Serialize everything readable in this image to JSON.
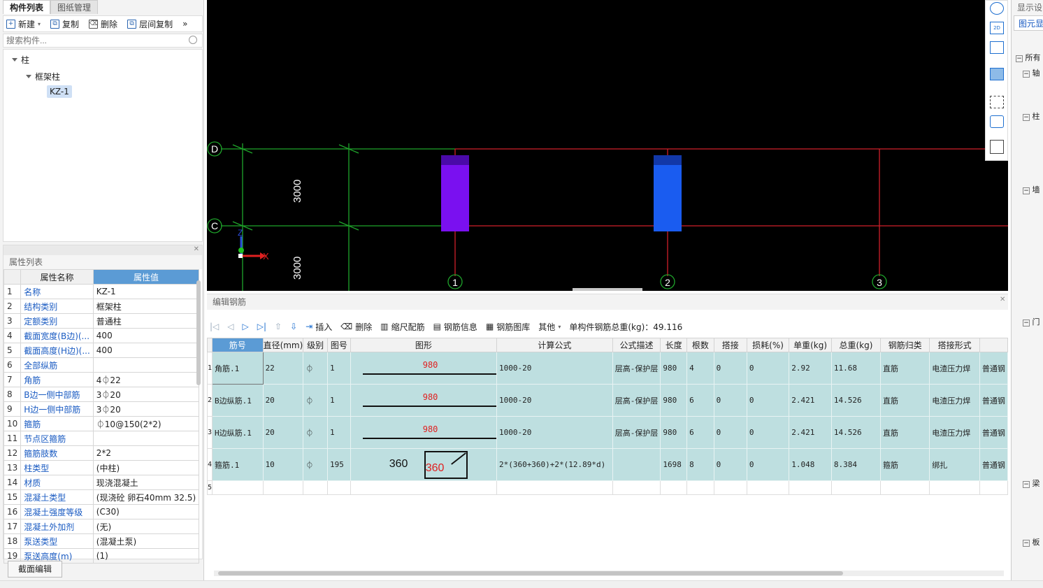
{
  "tabs": [
    "构件列表",
    "图纸管理"
  ],
  "toolbar": {
    "new": "新建",
    "copy": "复制",
    "delete": "删除",
    "floor_copy": "层间复制",
    "more": "»"
  },
  "search_placeholder": "搜索构件...",
  "tree": {
    "root": "柱",
    "child": "框架柱",
    "leaf": "KZ-1"
  },
  "props": {
    "title": "属性列表",
    "col_name": "属性名称",
    "col_value": "属性值",
    "rows": [
      {
        "n": "1",
        "name": "名称",
        "value": "KZ-1"
      },
      {
        "n": "2",
        "name": "结构类别",
        "value": "框架柱"
      },
      {
        "n": "3",
        "name": "定额类别",
        "value": "普通柱"
      },
      {
        "n": "4",
        "name": "截面宽度(B边)(...",
        "value": "400"
      },
      {
        "n": "5",
        "name": "截面高度(H边)(...",
        "value": "400"
      },
      {
        "n": "6",
        "name": "全部纵筋",
        "value": ""
      },
      {
        "n": "7",
        "name": "角筋",
        "value": "4⏀22"
      },
      {
        "n": "8",
        "name": "B边一侧中部筋",
        "value": "3⏀20"
      },
      {
        "n": "9",
        "name": "H边一侧中部筋",
        "value": "3⏀20"
      },
      {
        "n": "10",
        "name": "箍筋",
        "value": "⏀10@150(2*2)"
      },
      {
        "n": "11",
        "name": "节点区箍筋",
        "value": ""
      },
      {
        "n": "12",
        "name": "箍筋肢数",
        "value": "2*2"
      },
      {
        "n": "13",
        "name": "柱类型",
        "value": "(中柱)"
      },
      {
        "n": "14",
        "name": "材质",
        "value": "现浇混凝土"
      },
      {
        "n": "15",
        "name": "混凝土类型",
        "value": "(现浇砼 卵石40mm 32.5)"
      },
      {
        "n": "16",
        "name": "混凝土强度等级",
        "value": "(C30)"
      },
      {
        "n": "17",
        "name": "混凝土外加剂",
        "value": "(无)"
      },
      {
        "n": "18",
        "name": "泵送类型",
        "value": "(混凝土泵)"
      },
      {
        "n": "19",
        "name": "泵送高度(m)",
        "value": "(1)"
      }
    ],
    "button": "截面编辑"
  },
  "canvas": {
    "axis_rows": [
      "D",
      "C"
    ],
    "axis_cols": [
      "1",
      "2",
      "3"
    ],
    "dims": [
      "3000",
      "3000"
    ],
    "coord_z": "Z",
    "coord_x": "X",
    "colors": {
      "bg": "#000000",
      "grid_green": "#1fa52b",
      "grid_red": "#d0202a",
      "col1": "#7a10f0",
      "col2": "#1a5cf0"
    }
  },
  "right_panel": {
    "title": "显示设",
    "tab": "图元显",
    "items": [
      "所有",
      "轴",
      "柱",
      "墙",
      "门",
      "梁",
      "板"
    ]
  },
  "editor": {
    "title": "编辑钢筋",
    "tools": {
      "insert": "插入",
      "delete": "删除",
      "scale": "缩尺配筋",
      "info": "钢筋信息",
      "library": "钢筋图库",
      "other": "其他",
      "total": "单构件钢筋总重(kg)：49.116"
    },
    "headers": [
      "筋号",
      "直径(mm)",
      "级别",
      "图号",
      "图形",
      "计算公式",
      "公式描述",
      "长度",
      "根数",
      "搭接",
      "损耗(%)",
      "单重(kg)",
      "总重(kg)",
      "钢筋归类",
      "搭接形式",
      ""
    ],
    "rows": [
      {
        "n": "1",
        "name": "角筋.1",
        "dia": "22",
        "grade": "⏀",
        "fig": "1",
        "shape": "980",
        "formula": "1000-20",
        "desc": "层高-保护层",
        "len": "980",
        "count": "4",
        "lap": "0",
        "loss": "0",
        "unit": "2.92",
        "total": "11.68",
        "type": "直筋",
        "lapform": "电渣压力焊",
        "extra": "普通钢"
      },
      {
        "n": "2",
        "name": "B边纵筋.1",
        "dia": "20",
        "grade": "⏀",
        "fig": "1",
        "shape": "980",
        "formula": "1000-20",
        "desc": "层高-保护层",
        "len": "980",
        "count": "6",
        "lap": "0",
        "loss": "0",
        "unit": "2.421",
        "total": "14.526",
        "type": "直筋",
        "lapform": "电渣压力焊",
        "extra": "普通钢"
      },
      {
        "n": "3",
        "name": "H边纵筋.1",
        "dia": "20",
        "grade": "⏀",
        "fig": "1",
        "shape": "980",
        "formula": "1000-20",
        "desc": "层高-保护层",
        "len": "980",
        "count": "6",
        "lap": "0",
        "loss": "0",
        "unit": "2.421",
        "total": "14.526",
        "type": "直筋",
        "lapform": "电渣压力焊",
        "extra": "普通钢"
      },
      {
        "n": "4",
        "name": "箍筋.1",
        "dia": "10",
        "grade": "⏀",
        "fig": "195",
        "shape_a": "360",
        "shape_b": "360",
        "formula": "2*(360+360)+2*(12.89*d)",
        "desc": "",
        "len": "1698",
        "count": "8",
        "lap": "0",
        "loss": "0",
        "unit": "1.048",
        "total": "8.384",
        "type": "箍筋",
        "lapform": "绑扎",
        "extra": "普通钢"
      }
    ],
    "empty_row": "5"
  }
}
